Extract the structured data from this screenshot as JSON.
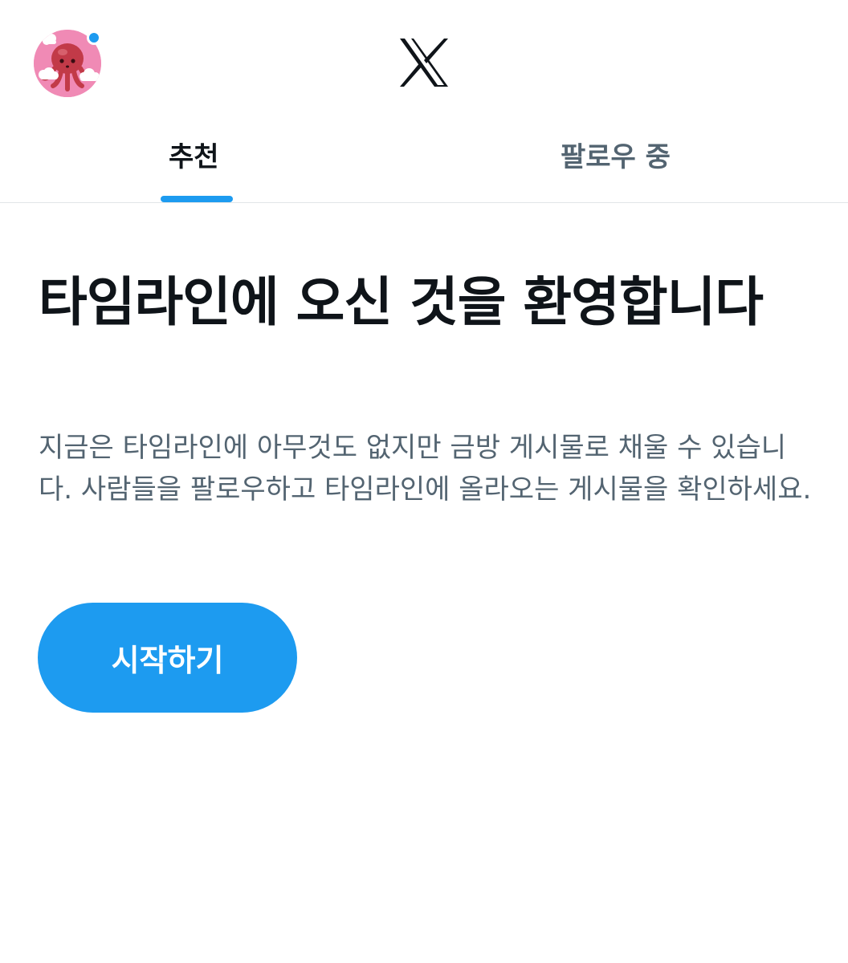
{
  "header": {
    "avatar_icon": "octopus-avatar-icon",
    "logo_icon": "x-logo-icon",
    "notification_dot_color": "#1d9bf0"
  },
  "tabs": [
    {
      "label": "추천",
      "active": true
    },
    {
      "label": "팔로우 중",
      "active": false
    }
  ],
  "main": {
    "headline": "타임라인에 오신 것을 환영합니다",
    "description": "지금은 타임라인에 아무것도 없지만 금방 게시물로 채울 수 있습니다. 사람들을 팔로우하고 타임라인에 올라오는 게시물을 확인하세요.",
    "start_button_label": "시작하기"
  },
  "colors": {
    "accent": "#1d9bf0",
    "text_primary": "#0f1419",
    "text_secondary": "#536471"
  }
}
